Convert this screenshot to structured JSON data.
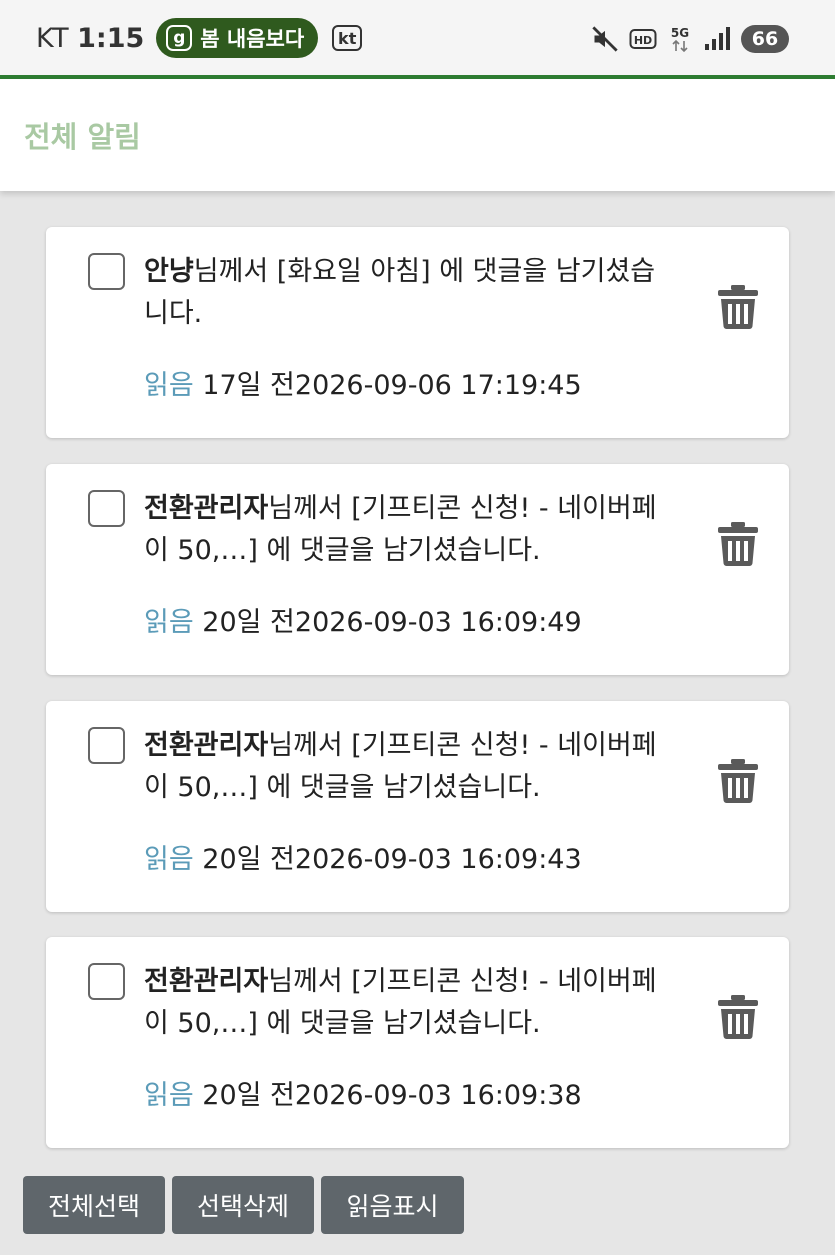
{
  "status_bar": {
    "carrier": "KT",
    "time": "1:15",
    "pill_icon": "g",
    "pill_text": "봄 내음보다",
    "kt_logo": "kt",
    "battery": "66"
  },
  "header": {
    "title": "전체 알림",
    "title_color": "#a9c9a3"
  },
  "notifications": [
    {
      "author": "안냥",
      "body_line1": "님께서 [화요일 아침] 에 댓글을 남기셨습",
      "body_line2": "니다.",
      "status": "읽음",
      "time": "17일 전2026-09-06 17:19:45"
    },
    {
      "author": "전환관리자",
      "body_line1": "님께서 [기프티콘 신청! - 네이버페",
      "body_line2": "이 50,…] 에 댓글을 남기셨습니다.",
      "status": "읽음",
      "time": "20일 전2026-09-03 16:09:49"
    },
    {
      "author": "전환관리자",
      "body_line1": "님께서 [기프티콘 신청! - 네이버페",
      "body_line2": "이 50,…] 에 댓글을 남기셨습니다.",
      "status": "읽음",
      "time": "20일 전2026-09-03 16:09:43"
    },
    {
      "author": "전환관리자",
      "body_line1": "님께서 [기프티콘 신청! - 네이버페",
      "body_line2": "이 50,…] 에 댓글을 남기셨습니다.",
      "status": "읽음",
      "time": "20일 전2026-09-03 16:09:38"
    }
  ],
  "actions": {
    "select_all": "전체선택",
    "delete_selected": "선택삭제",
    "mark_read": "읽음표시"
  },
  "colors": {
    "accent_green": "#2e7d32",
    "read_label": "#5b9bb8",
    "button_bg": "#5f666b"
  }
}
